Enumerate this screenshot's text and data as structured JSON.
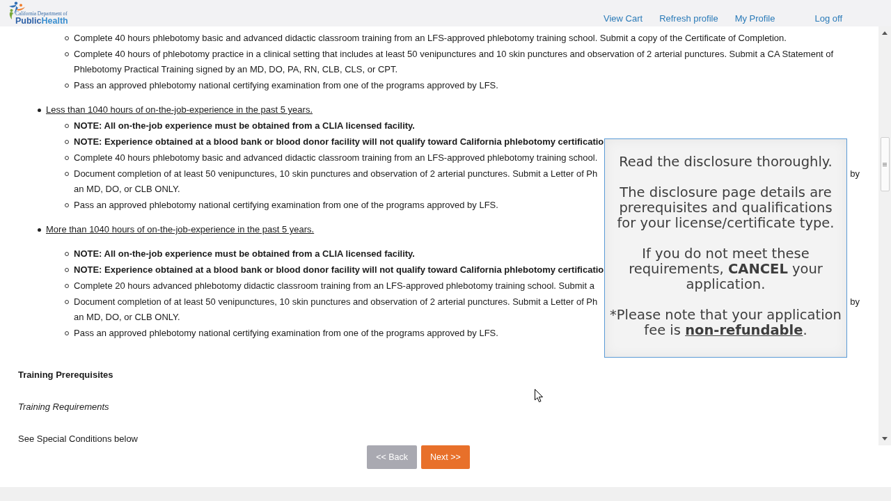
{
  "header": {
    "logo": {
      "caption": "California Department of",
      "word_1": "Public",
      "word_2": "Health"
    },
    "nav_links": [
      {
        "label": "View Cart"
      },
      {
        "label": "Refresh profile"
      },
      {
        "label": "My Profile"
      },
      {
        "label": "Log off"
      }
    ]
  },
  "requirements": {
    "continued_items": [
      {
        "text": "Complete 40 hours phlebotomy basic and advanced didactic classroom training from an LFS-approved phlebotomy training school. Submit a copy of the Certificate of Completion.",
        "bold": false
      },
      {
        "text": "Complete 40 hours of phlebotomy practice in a clinical setting that includes at least 50 venipunctures and 10 skin punctures and observation of 2 arterial punctures. Submit a CA Statement of Phlebotomy Practical Training signed by an MD, DO, PA, RN, CLB, CLS, or CPT.",
        "bold": false
      },
      {
        "text": "Pass an approved phlebotomy national certifying examination from one of the programs approved by LFS.",
        "bold": false
      }
    ],
    "options": [
      {
        "label": "Less than 1040 hours of on-the-job-experience in the past 5 years.",
        "items": [
          {
            "text": "NOTE: All on-the-job experience must be obtained from a CLIA licensed facility.",
            "bold": true
          },
          {
            "text": "NOTE: Experience obtained at a blood bank or blood donor facility will not qualify toward California phlebotomy certificatio",
            "bold": true
          },
          {
            "text": "Complete 40 hours phlebotomy basic and advanced didactic classroom training from an LFS-approved phlebotomy training school.",
            "bold": false
          },
          {
            "text": "Document completion of at least 50 venipunctures, 10 skin punctures and observation of 2 arterial punctures. Submit a Letter of Ph",
            "bold": false,
            "right_fragment": "by",
            "continuation": "an MD, DO, or CLB ONLY."
          },
          {
            "text": "Pass an approved phlebotomy national certifying examination from one of the programs approved by LFS.",
            "bold": false
          }
        ]
      },
      {
        "label": "More than 1040 hours of on-the-job-experience in the past 5 years.",
        "items": [
          {
            "text": "NOTE: All on-the-job experience must be obtained from a CLIA licensed facility.",
            "bold": true
          },
          {
            "text": "NOTE: Experience obtained at a blood bank or blood donor facility will not qualify toward California phlebotomy certificatio",
            "bold": true
          },
          {
            "text": "Complete 20 hours advanced phlebotomy didactic classroom training from an LFS-approved phlebotomy training school. Submit a",
            "bold": false
          },
          {
            "text": "Document completion of at least 50 venipunctures, 10 skin punctures and observation of 2 arterial punctures. Submit a Letter of Ph",
            "bold": false,
            "right_fragment": "by",
            "continuation": "an MD, DO, or CLB ONLY."
          },
          {
            "text": "Pass an approved phlebotomy national certifying examination from one of the programs approved by LFS.",
            "bold": false
          }
        ]
      }
    ]
  },
  "sections": [
    {
      "kind": "heading",
      "text": "Training Prerequisites"
    },
    {
      "kind": "subheading",
      "text": "Training Requirements"
    },
    {
      "kind": "note",
      "text": "See Special Conditions below"
    }
  ],
  "buttons": [
    {
      "label": "<< Back",
      "kind": "secondary"
    },
    {
      "label": "Next >>",
      "kind": "primary"
    }
  ],
  "disclosure_popup": {
    "paragraphs": [
      {
        "text": "Read the disclosure thoroughly."
      },
      {
        "text": "The disclosure page details are prerequisites and qualifications for your license/certificate type."
      },
      {
        "text": "If you do not meet these requirements, **CANCEL** your application.",
        "underline_bold": false
      },
      {
        "text": "*Please note that your application fee is **non-refundable**.",
        "underline_bold": true
      }
    ]
  }
}
